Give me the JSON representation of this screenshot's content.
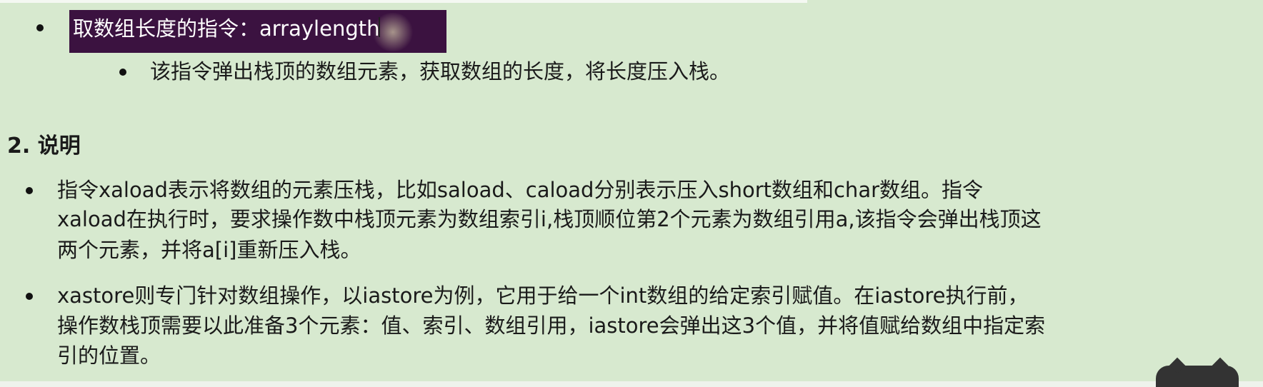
{
  "list_top": {
    "item1_text": "取数组长度的指令：arraylength",
    "item1_sub": "该指令弹出栈顶的数组元素，获取数组的长度，将长度压入栈。"
  },
  "section2": {
    "heading": "2. 说明",
    "p1_l1": "指令xaload表示将数组的元素压栈，比如saload、caload分别表示压入short数组和char数组。指令",
    "p1_l2": "xaload在执行时，要求操作数中栈顶元素为数组索引i,栈顶顺位第2个元素为数组引用a,该指令会弹出栈顶这",
    "p1_l3": "两个元素，并将a[i]重新压入栈。",
    "p2_l1": "xastore则专门针对数组操作，以iastore为例，它用于给一个int数组的给定索引赋值。在iastore执行前，",
    "p2_l2": "操作数栈顶需要以此准备3个元素：值、索引、数组引用，iastore会弹出这3个值，并将值赋给数组中指定索",
    "p2_l3": "引的位置。"
  }
}
